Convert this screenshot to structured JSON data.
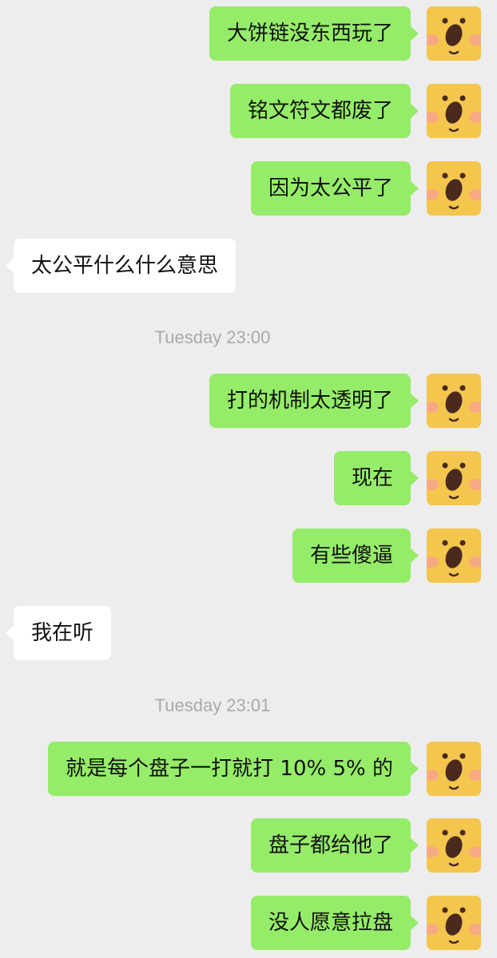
{
  "colors": {
    "background": "#ededed",
    "bubble_mine": "#95ec69",
    "bubble_theirs": "#ffffff",
    "avatar_bg": "#f4c64e",
    "timestamp": "#a9a9a9"
  },
  "chat": {
    "messages": [
      {
        "sender": "me",
        "text": "大饼链没东西玩了"
      },
      {
        "sender": "me",
        "text": "铭文符文都废了"
      },
      {
        "sender": "me",
        "text": "因为太公平了"
      },
      {
        "sender": "other",
        "text": "太公平什么什么意思"
      },
      {
        "sender": "system",
        "text": "Tuesday 23:00"
      },
      {
        "sender": "me",
        "text": "打的机制太透明了"
      },
      {
        "sender": "me",
        "text": "现在"
      },
      {
        "sender": "me",
        "text": "有些傻逼"
      },
      {
        "sender": "other",
        "text": "我在听"
      },
      {
        "sender": "system",
        "text": "Tuesday 23:01"
      },
      {
        "sender": "me",
        "text": "就是每个盘子一打就打 10% 5% 的"
      },
      {
        "sender": "me",
        "text": "盘子都给他了"
      },
      {
        "sender": "me",
        "text": "没人愿意拉盘"
      }
    ],
    "avatar_icon": "surprised-face-icon"
  }
}
